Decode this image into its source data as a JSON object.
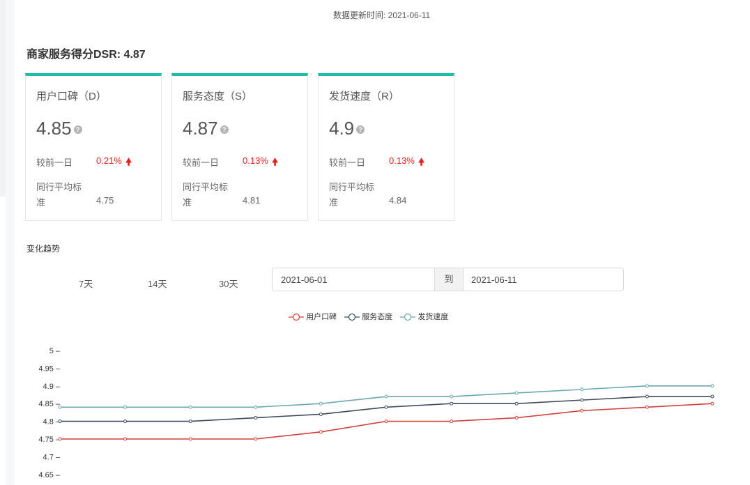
{
  "header": {
    "update_time": "数据更新时间: 2021-06-11"
  },
  "dsr": {
    "title": "商家服务得分DSR: 4.87"
  },
  "cards": [
    {
      "title": "用户口碑（D）",
      "score": "4.85",
      "cmp_label": "较前一日",
      "cmp_value": "0.21%",
      "avg_label_line1": "同行平均标",
      "avg_label_line2": "准",
      "avg_value": "4.75"
    },
    {
      "title": "服务态度（S）",
      "score": "4.87",
      "cmp_label": "较前一日",
      "cmp_value": "0.13%",
      "avg_label_line1": "同行平均标",
      "avg_label_line2": "准",
      "avg_value": "4.81"
    },
    {
      "title": "发货速度（R）",
      "score": "4.9",
      "cmp_label": "较前一日",
      "cmp_value": "0.13%",
      "avg_label_line1": "同行平均标",
      "avg_label_line2": "准",
      "avg_value": "4.84"
    }
  ],
  "trend": {
    "title": "变化趋势",
    "ranges": [
      "7天",
      "14天",
      "30天"
    ],
    "date_from": "2021-06-01",
    "date_sep": "到",
    "date_to": "2021-06-11"
  },
  "colors": {
    "accent": "#1fbcaa",
    "up": "#e4211b"
  },
  "chart_data": {
    "type": "line",
    "ylim": [
      4.62,
      5
    ],
    "yticks": [
      "5",
      "4.95",
      "4.9",
      "4.85",
      "4.8",
      "4.75",
      "4.7",
      "4.65"
    ],
    "series": [
      {
        "name": "用户口碑",
        "color": "#d1403d",
        "values": [
          4.75,
          4.75,
          4.75,
          4.75,
          4.77,
          4.8,
          4.8,
          4.81,
          4.83,
          4.84,
          4.85
        ]
      },
      {
        "name": "服务态度",
        "color": "#3f4a5a",
        "values": [
          4.8,
          4.8,
          4.8,
          4.81,
          4.82,
          4.84,
          4.85,
          4.85,
          4.86,
          4.87,
          4.87
        ]
      },
      {
        "name": "发货速度",
        "color": "#6aa8ad",
        "values": [
          4.84,
          4.84,
          4.84,
          4.84,
          4.85,
          4.87,
          4.87,
          4.88,
          4.89,
          4.9,
          4.9
        ]
      }
    ]
  }
}
